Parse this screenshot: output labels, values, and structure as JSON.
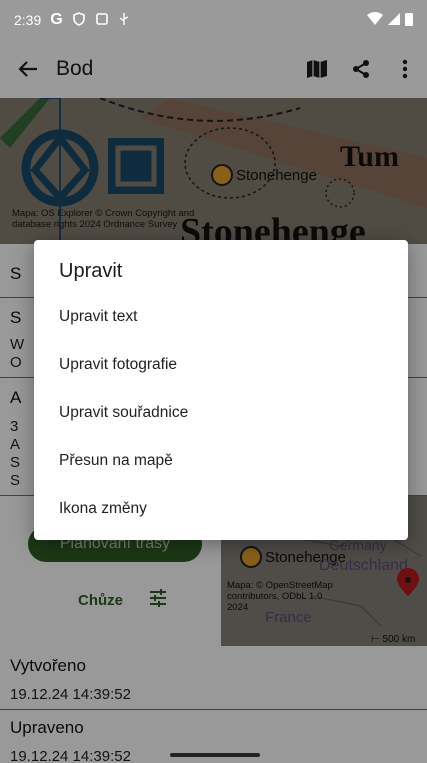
{
  "status": {
    "time": "2:39"
  },
  "appbar": {
    "title": "Bod"
  },
  "map_top": {
    "place_label": "Stonehenge",
    "attribution": "Mapa: OS Explorer © Crown Copyright and database rights 2024 Ordnance Survey"
  },
  "rows": {
    "r1_label": "S",
    "r2_label": "S",
    "r2_line1": "W",
    "r2_line2": "O",
    "r3_label": "A",
    "r3_line1": "3",
    "r3_line2": "A",
    "r3_line3": "S",
    "r3_line4": "S"
  },
  "actions": {
    "plan_button": "Plánování trasy",
    "mode": "Chůze"
  },
  "map_bottom": {
    "place_label": "Stonehenge",
    "country1": "Germany",
    "country2": "Deutschland",
    "country3": "France",
    "attribution": "Mapa: © OpenStreetMap contributors, ODbL 1.0 2024",
    "scale": "500 km"
  },
  "created": {
    "label": "Vytvořeno",
    "value": "19.12.24 14:39:52"
  },
  "updated": {
    "label": "Upraveno",
    "value": "19.12.24 14:39:52"
  },
  "dialog": {
    "title": "Upravit",
    "items": [
      "Upravit text",
      "Upravit fotografie",
      "Upravit souřadnice",
      "Přesun na mapě",
      "Ikona změny"
    ]
  },
  "colors": {
    "primary": "#2f5e26",
    "marker": "#e3a02e",
    "pin": "#b71c1c"
  }
}
